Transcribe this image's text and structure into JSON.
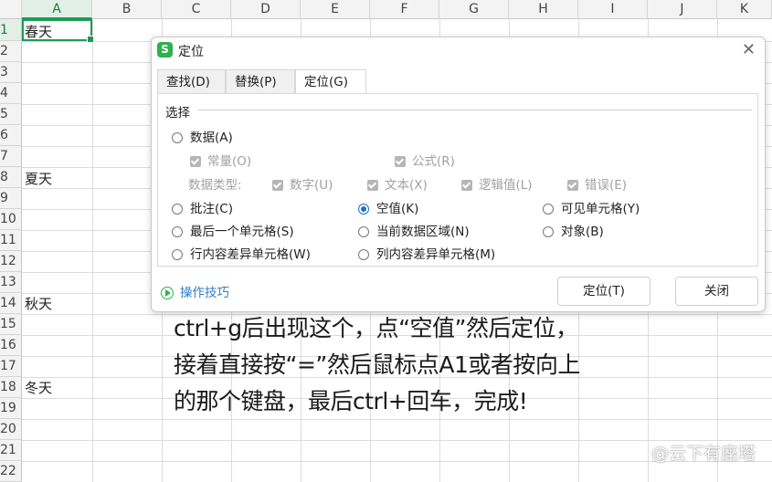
{
  "columns": [
    "A",
    "B",
    "C",
    "D",
    "E",
    "F",
    "G",
    "H",
    "I",
    "J",
    "K"
  ],
  "rows": [
    "1",
    "2",
    "3",
    "4",
    "5",
    "6",
    "7",
    "8",
    "9",
    "10",
    "11",
    "12",
    "13",
    "14",
    "15",
    "16",
    "17",
    "18",
    "19",
    "20",
    "21",
    "22"
  ],
  "cells": {
    "A1": "春天",
    "A8": "夏天",
    "A14": "秋天",
    "A18": "冬天"
  },
  "dialog": {
    "icon_letter": "S",
    "title": "定位",
    "close_glyph": "✕",
    "tabs": [
      "查找(D)",
      "替换(P)",
      "定位(G)"
    ],
    "section_label": "选择",
    "options": {
      "data": "数据(A)",
      "constant": "常量(O)",
      "formula": "公式(R)",
      "data_type_label": "数据类型:",
      "number": "数字(U)",
      "text": "文本(X)",
      "logical": "逻辑值(L)",
      "error": "错误(E)",
      "comment": "批注(C)",
      "blank": "空值(K)",
      "visible_cells": "可见单元格(Y)",
      "last_cell": "最后一个单元格(S)",
      "current_region": "当前数据区域(N)",
      "objects": "对象(B)",
      "row_diff": "行内容差异单元格(W)",
      "col_diff": "列内容差异单元格(M)"
    },
    "selected_option": "blank",
    "tips_link": "操作技巧",
    "locate_button": "定位(T)",
    "close_button": "关闭"
  },
  "caption_lines": [
    "ctrl+g后出现这个，点“空值”然后定位，",
    "接着直接按“=”然后鼠标点A1或者按向上",
    "的那个键盘，最后ctrl+回车，完成!"
  ],
  "watermark": "@云下有座塔"
}
